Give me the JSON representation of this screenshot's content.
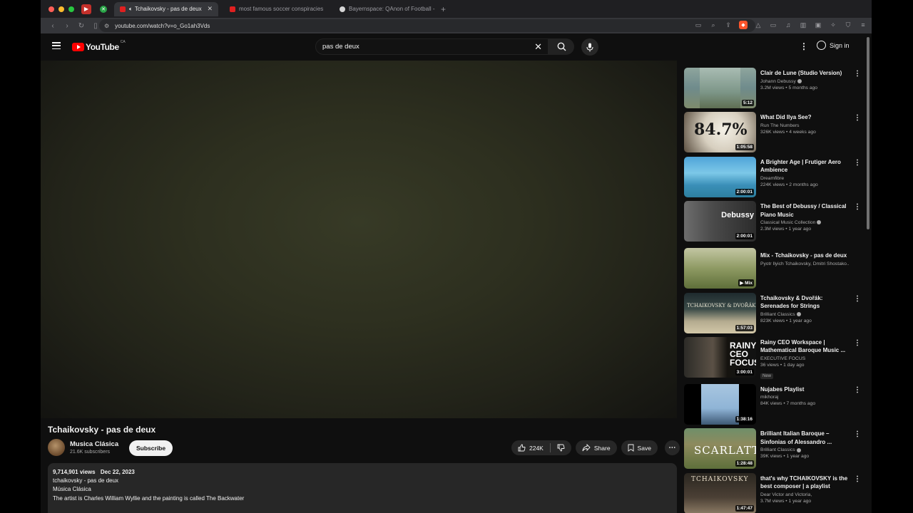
{
  "browser": {
    "tabs": [
      {
        "title": "Tchaikovsky - pas de deux",
        "active": true
      },
      {
        "title": "most famous soccer conspiracies",
        "active": false
      },
      {
        "title": "Bayernspace: QAnon of Football -",
        "active": false
      }
    ],
    "url": "youtube.com/watch?v=o_Go1ah3Vds"
  },
  "header": {
    "logo_text": "YouTube",
    "logo_country": "CA",
    "search_value": "pas de deux",
    "signin_label": "Sign in"
  },
  "video": {
    "title": "Tchaikovsky - pas de deux",
    "channel_name": "Musica Clásica",
    "subscribers": "21.6K subscribers",
    "subscribe_label": "Subscribe",
    "likes": "224K",
    "share_label": "Share",
    "save_label": "Save",
    "views": "9,714,901 views",
    "date": "Dec 22, 2023",
    "description_lines": [
      "tchaikovsky - pas de deux",
      "Música Clásica",
      "The artist is Charles William Wyllie and the painting is called The Backwater"
    ]
  },
  "recommendations": [
    {
      "title": "Clair de Lune (Studio Version)",
      "channel": "Johann Debussy",
      "verified": true,
      "meta": "3.2M views • 5 months ago",
      "duration": "5:12"
    },
    {
      "title": "What Did Ilya See?",
      "channel": "Run The Numbers",
      "verified": false,
      "meta": "326K views • 4 weeks ago",
      "duration": "1:05:58",
      "thumb_text": "84.7%"
    },
    {
      "title": "A Brighter Age | Frutiger Aero Ambience",
      "channel": "Dreamfibre",
      "verified": false,
      "meta": "224K views • 2 months ago",
      "duration": "2:00:01"
    },
    {
      "title": "The Best of Debussy / Classical Piano Music",
      "channel": "Classical Music Collection",
      "verified": true,
      "meta": "2.3M views • 1 year ago",
      "duration": "2:00:01",
      "thumb_text": "Debussy"
    },
    {
      "title": "Mix - Tchaikovsky - pas de deux",
      "channel": "Pyotr Ilyich Tchaikovsky, Dmitri Shostako...",
      "verified": false,
      "meta": "",
      "duration": "Mix"
    },
    {
      "title": "Tchaikovsky & Dvořák: Serenades for Strings",
      "channel": "Brilliant Classics",
      "verified": true,
      "meta": "823K views • 1 year ago",
      "duration": "1:57:03",
      "thumb_text": "TCHAIKOVSKY & DVOŘÁK"
    },
    {
      "title": "Rainy CEO Workspace | Mathematical Baroque Music ...",
      "channel": "EXECUTIVE FOCUS",
      "verified": false,
      "meta": "36 views • 1 day ago",
      "duration": "3:00:01",
      "badge": "New",
      "thumb_text": "RAINY CEO FOCUS"
    },
    {
      "title": "Nujabes Playlist",
      "channel": "mikhoraj",
      "verified": false,
      "meta": "84K views • 7 months ago",
      "duration": "1:38:16"
    },
    {
      "title": "Brilliant Italian Baroque – Sinfonias of Alessandro ...",
      "channel": "Brilliant Classics",
      "verified": true,
      "meta": "39K views • 1 year ago",
      "duration": "1:28:48",
      "thumb_text": "SCARLATTI"
    },
    {
      "title": "that's why TCHAIKOVSKY is the best composer | a playlist",
      "channel": "Dear Victor and Victoria,",
      "verified": false,
      "meta": "3.7M views • 1 year ago",
      "duration": "1:47:47",
      "thumb_text": "TCHAIKOVSKY"
    }
  ]
}
